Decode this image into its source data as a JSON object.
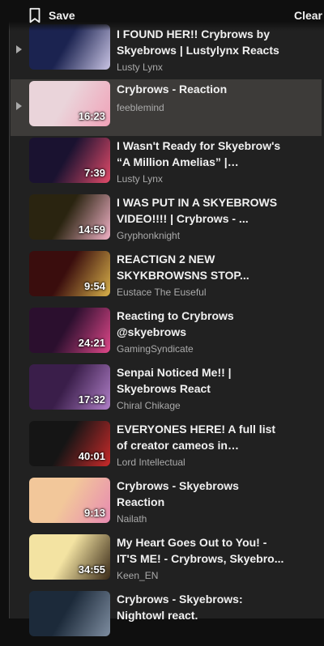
{
  "header": {
    "save_label": "Save",
    "clear_label": "Clear"
  },
  "videos": [
    {
      "title": "I FOUND HER!!  Crybrows  by Skyebrows | Lustylynx Reacts",
      "channel": "Lusty Lynx",
      "duration": "",
      "colors": [
        "#1b2350",
        "#c9c4e4"
      ]
    },
    {
      "title": "Crybrows - Reaction",
      "channel": "feeblemind",
      "duration": "16:23",
      "colors": [
        "#ead4da",
        "#f0a2b8"
      ]
    },
    {
      "title": "I Wasn't Ready for Skyebrow's “A Million Amelias” | Lustylynx...",
      "channel": "Lusty Lynx",
      "duration": "7:39",
      "colors": [
        "#1a1230",
        "#e34b6a"
      ]
    },
    {
      "title": "I WAS PUT IN A SKYEBROWS VIDEO!!!! | Crybrows - ...",
      "channel": "Gryphonknight",
      "duration": "14:59",
      "colors": [
        "#2a2410",
        "#f1b2c7"
      ]
    },
    {
      "title": "REACTIGN 2 NEW SKYKBROWSNS STOP...",
      "channel": "Eustace The Euseful",
      "duration": "9:54",
      "colors": [
        "#3a0d0d",
        "#d8b14a"
      ]
    },
    {
      "title": "Reacting to Crybrows @skyebrows",
      "channel": "GamingSyndicate",
      "duration": "24:21",
      "colors": [
        "#2b0f2e",
        "#e0488a"
      ]
    },
    {
      "title": "Senpai Noticed Me!! | Skyebrows React",
      "channel": "Chiral Chikage",
      "duration": "17:32",
      "colors": [
        "#3a1e4a",
        "#b07fc8"
      ]
    },
    {
      "title": "EVERYONES HERE! A full list of creator cameos in \"Crybrows\"",
      "channel": "Lord Intellectual",
      "duration": "40:01",
      "colors": [
        "#151515",
        "#c92a2a"
      ]
    },
    {
      "title": "Crybrows - Skyebrows Reaction",
      "channel": "Nailath",
      "duration": "9:13",
      "colors": [
        "#f2c79a",
        "#e78ab1"
      ]
    },
    {
      "title": "My Heart Goes Out to You! - IT'S ME! - Crybrows, Skyebro...",
      "channel": "Keen_EN",
      "duration": "34:55",
      "colors": [
        "#f3e3a2",
        "#3a2a18"
      ]
    },
    {
      "title": "Crybrows - Skyebrows: Nightowl react.",
      "channel": "",
      "duration": "",
      "colors": [
        "#1c2a3a",
        "#7e8da0"
      ]
    }
  ]
}
